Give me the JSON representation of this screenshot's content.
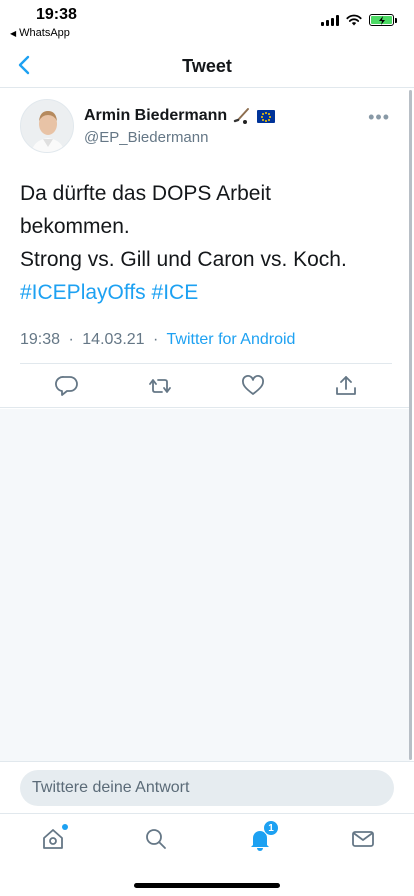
{
  "status_bar": {
    "time": "19:38",
    "back_app": "WhatsApp"
  },
  "header": {
    "title": "Tweet"
  },
  "tweet": {
    "author_name": "Armin Biedermann",
    "author_badges": [
      "hockey-stick-emoji",
      "eu-flag-emoji"
    ],
    "author_handle": "@EP_Biedermann",
    "text_lines": [
      "Da dürfte das DOPS Arbeit",
      "bekommen.",
      "Strong vs. Gill und Caron vs. Koch."
    ],
    "hashtags": [
      "#ICEPlayOffs",
      "#ICE"
    ],
    "time": "19:38",
    "date": "14.03.21",
    "separator": "·",
    "source": "Twitter for Android"
  },
  "reply": {
    "placeholder": "Twittere deine Antwort"
  },
  "tabbar": {
    "notifications_badge": "1"
  },
  "colors": {
    "accent": "#1da1f2",
    "secondary_text": "#657786",
    "divider": "#e1e8ed",
    "background_empty": "#f5f8fa"
  }
}
